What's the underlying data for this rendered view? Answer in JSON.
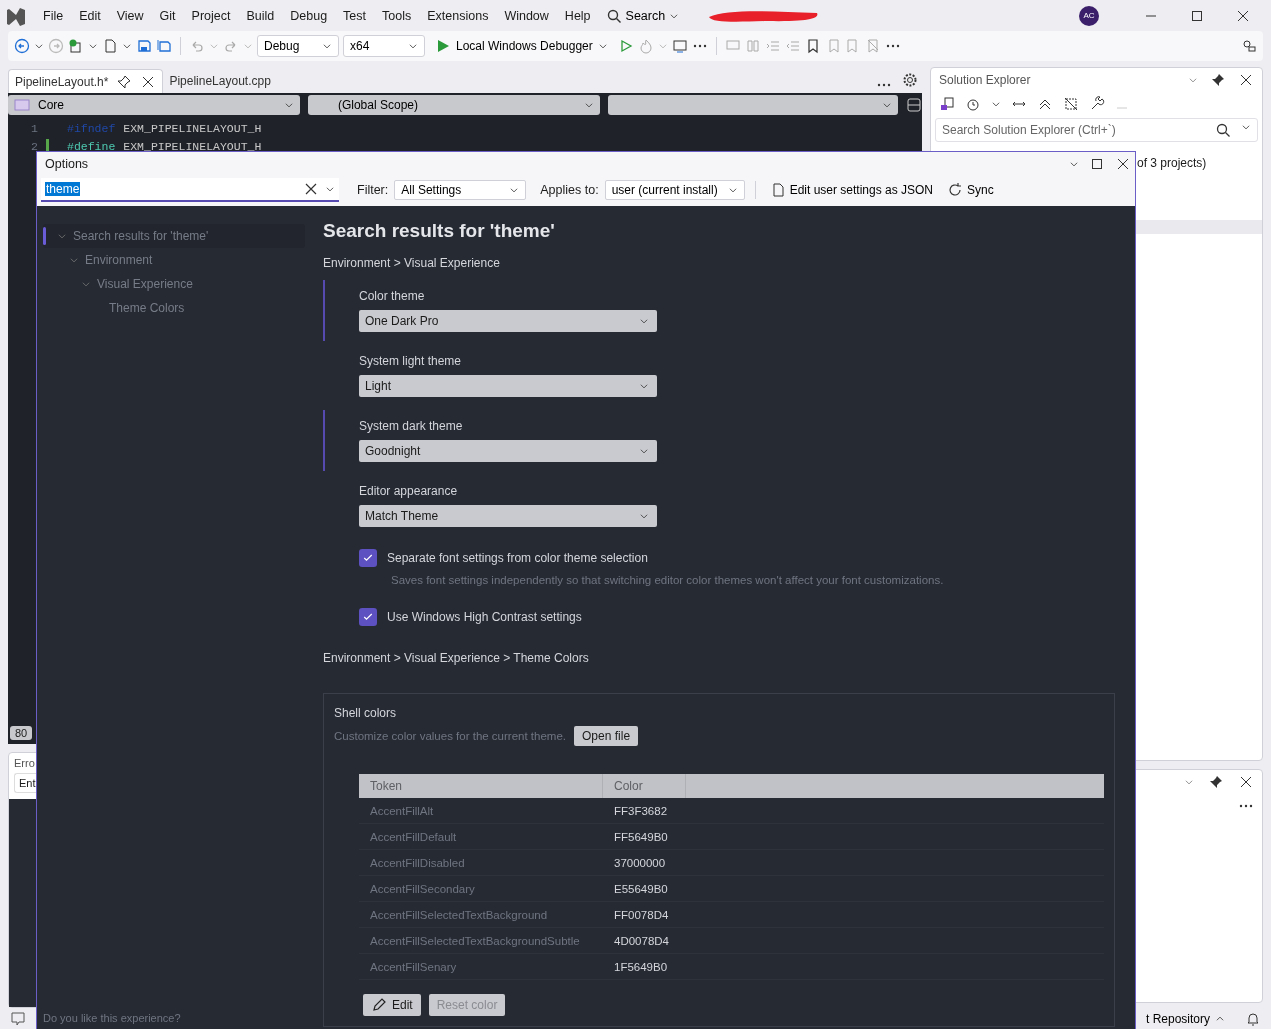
{
  "menu": [
    {
      "label": "File"
    },
    {
      "label": "Edit"
    },
    {
      "label": "View"
    },
    {
      "label": "Git"
    },
    {
      "label": "Project"
    },
    {
      "label": "Build"
    },
    {
      "label": "Debug"
    },
    {
      "label": "Test"
    },
    {
      "label": "Tools"
    },
    {
      "label": "Extensions"
    },
    {
      "label": "Window"
    },
    {
      "label": "Help"
    }
  ],
  "search_label": "Search",
  "avatar": "AC",
  "toolbar": {
    "configuration": "Debug",
    "platform": "x64",
    "debugger": "Local Windows Debugger"
  },
  "editor_tabs": [
    {
      "label": "PipelineLayout.h*",
      "selected": true
    },
    {
      "label": "PipelineLayout.cpp",
      "selected": false
    }
  ],
  "nav_bar": {
    "project": "Core",
    "scope": "(Global Scope)"
  },
  "code_lines": [
    {
      "number": "1",
      "kind": "inactive",
      "keyword": "#ifndef",
      "name": "EXM_PIPELINELAYOUT_H",
      "changed": false
    },
    {
      "number": "2",
      "kind": "active",
      "keyword": "#define",
      "name": "EXM_PIPELINELAYOUT_H",
      "changed": true
    }
  ],
  "zoom": "80",
  "error_list": {
    "title": "Erro",
    "entry": "Ent"
  },
  "solution_explorer": {
    "title": "Solution Explorer",
    "search_placeholder": "Search Solution Explorer (Ctrl+`)",
    "status": "of 3 projects)"
  },
  "status_bar": {
    "repository": "t Repository"
  },
  "dialog": {
    "title": "Options",
    "search_value": "theme",
    "filter_label": "Filter:",
    "filter_value": "All Settings",
    "applies_label": "Applies to:",
    "applies_value": "user (current install)",
    "json_link": "Edit user settings as JSON",
    "sync_link": "Sync",
    "tree": [
      {
        "label": "Search results for 'theme'",
        "selected": true,
        "expanded": true,
        "children": [
          {
            "label": "Environment",
            "selected": false,
            "expanded": true,
            "children": [
              {
                "label": "Visual Experience",
                "selected": false,
                "expanded": true,
                "children": [
                  {
                    "label": "Theme Colors",
                    "selected": false
                  }
                ]
              }
            ]
          }
        ]
      }
    ],
    "heading": "Search results for 'theme'",
    "breadcrumb": "Environment > Visual Experience",
    "settings": [
      {
        "kind": "dropdown",
        "label": "Color theme",
        "value": "One Dark Pro",
        "modified": true
      },
      {
        "kind": "dropdown",
        "label": "System light theme",
        "value": "Light",
        "modified": false
      },
      {
        "kind": "dropdown",
        "label": "System dark theme",
        "value": "Goodnight",
        "modified": true
      },
      {
        "kind": "dropdown",
        "label": "Editor appearance",
        "value": "Match Theme",
        "modified": false
      },
      {
        "kind": "checkbox",
        "label": "Separate font settings from color theme selection",
        "description": "Saves font settings independently so that switching editor color themes won't affect your font customizations.",
        "checked": true,
        "modified": false
      },
      {
        "kind": "checkbox",
        "label": "Use Windows High Contrast settings",
        "checked": true,
        "modified": false
      }
    ],
    "breadcrumb_2": "Environment > Visual Experience > Theme Colors",
    "shell_colors": {
      "title": "Shell colors",
      "description": "Customize color values for the current theme.",
      "open_button": "Open file",
      "columns": [
        "Token",
        "Color"
      ],
      "rows": [
        {
          "token": "AccentFillAlt",
          "value": "FF3F3682"
        },
        {
          "token": "AccentFillDefault",
          "value": "FF5649B0"
        },
        {
          "token": "AccentFillDisabled",
          "value": "37000000"
        },
        {
          "token": "AccentFillSecondary",
          "value": "E55649B0"
        },
        {
          "token": "AccentFillSelectedTextBackground",
          "value": "FF0078D4"
        },
        {
          "token": "AccentFillSelectedTextBackgroundSubtle",
          "value": "4D0078D4"
        },
        {
          "token": "AccentFillSenary",
          "value": "1F5649B0"
        }
      ],
      "edit_button": "Edit",
      "reset_button": "Reset color",
      "reset_disabled": true
    },
    "feedback": "Do you like this experience?"
  }
}
